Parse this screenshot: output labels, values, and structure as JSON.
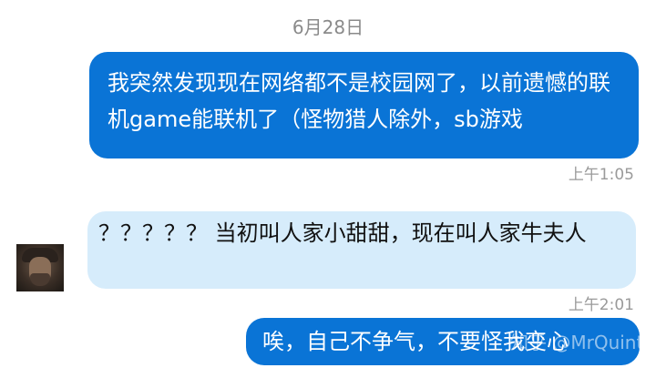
{
  "date_header": "6月28日",
  "messages": [
    {
      "direction": "outgoing",
      "text": "我突然发现现在网络都不是校园网了，以前遗憾的联机game能联机了（怪物猎人除外，sb游戏",
      "time": "上午1:05"
    },
    {
      "direction": "incoming",
      "avatar": "bearded-man-avatar",
      "text": "？？？？？ 当初叫人家小甜甜，现在叫人家牛夫人",
      "time": "上午2:01"
    },
    {
      "direction": "outgoing",
      "text": "唉，自己不争气，不要怪我变心"
    }
  ],
  "watermark": "知乎 @MrQuint",
  "colors": {
    "outgoing_bubble": "#0a74d6",
    "incoming_bubble": "#d6ecfb",
    "timestamp": "#9a9a9a"
  }
}
